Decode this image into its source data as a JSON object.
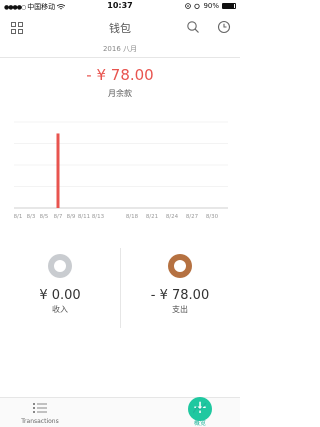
{
  "status_bar": {
    "carrier": "中国移动",
    "time": "10:37",
    "battery": "90%"
  },
  "header": {
    "title": "钱包"
  },
  "month_label": "2016 八月",
  "balance": {
    "amount": "- ¥ 78.00",
    "label": "月余款"
  },
  "colors": {
    "accent": "#e8544f",
    "green": "#1fc8a0",
    "silver_coin": "#c9ccd0",
    "bronze_coin": "#b57141"
  },
  "chart_data": {
    "type": "bar",
    "categories": [
      "8/1",
      "8/3",
      "8/5",
      "8/7",
      "8/9",
      "8/11",
      "8/13",
      "8/18",
      "8/21",
      "8/24",
      "8/27",
      "8/30"
    ],
    "values": [
      0,
      0,
      0,
      78,
      0,
      0,
      0,
      0,
      0,
      0,
      0,
      0
    ],
    "ylim": [
      0,
      90
    ],
    "grid": true
  },
  "summary": {
    "income": {
      "amount": "¥ 0.00",
      "label": "收入"
    },
    "expense": {
      "amount": "- ¥ 78.00",
      "label": "支出"
    }
  },
  "tabbar": {
    "transactions": "Transactions",
    "add": "+",
    "overview": "概览"
  }
}
